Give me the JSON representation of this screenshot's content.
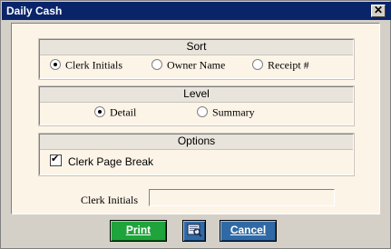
{
  "window": {
    "title": "Daily Cash",
    "close_glyph": "✕"
  },
  "sort": {
    "title": "Sort",
    "options": [
      {
        "label": "Clerk Initials",
        "selected": true
      },
      {
        "label": "Owner Name",
        "selected": false
      },
      {
        "label": "Receipt #",
        "selected": false
      }
    ]
  },
  "level": {
    "title": "Level",
    "options": [
      {
        "label": "Detail",
        "selected": true
      },
      {
        "label": "Summary",
        "selected": false
      }
    ]
  },
  "options": {
    "title": "Options",
    "clerk_page_break": {
      "label": "Clerk Page Break",
      "checked": true
    }
  },
  "clerk_initials_field": {
    "label": "Clerk Initials",
    "value": ""
  },
  "buttons": {
    "print": "Print",
    "preview_icon": "print-preview-icon",
    "cancel": "Cancel"
  },
  "colors": {
    "print_button": "#1ea43a",
    "cancel_button": "#2f6aa6",
    "titlebar": "#0a246a",
    "form_background": "#fdf4e8"
  }
}
